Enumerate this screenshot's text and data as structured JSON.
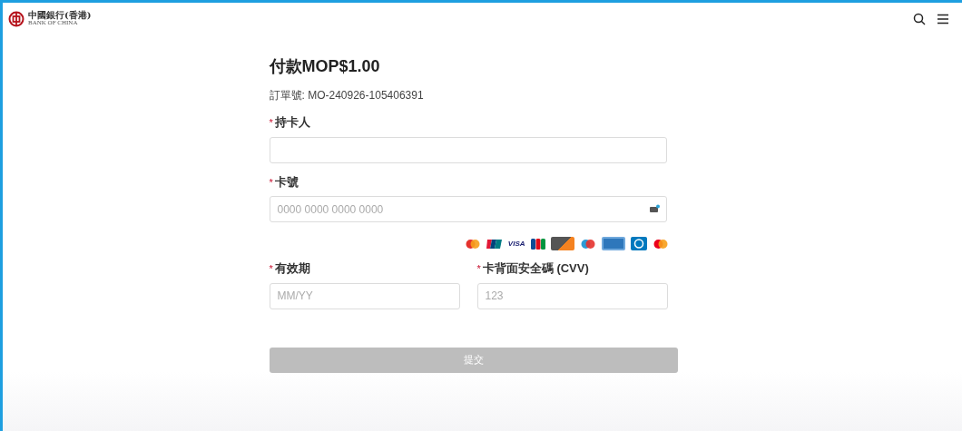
{
  "header": {
    "logo_text": "中國銀行(香港)",
    "logo_subtext": "BANK OF CHINA"
  },
  "title": "付款MOP$1.00",
  "order": "訂單號: MO-240926-105406391",
  "required_mark": "*",
  "holder": {
    "label": "持卡人",
    "required": true
  },
  "card_number": {
    "label": "卡號",
    "required": true,
    "placeholder": "0000 0000 0000 0000"
  },
  "brands": [
    {
      "kind": "mastercard-old"
    },
    {
      "kind": "unionpay"
    },
    {
      "kind": "visa",
      "label": "VISA"
    },
    {
      "kind": "jcb"
    },
    {
      "kind": "discover"
    },
    {
      "kind": "maestro"
    },
    {
      "kind": "amex"
    },
    {
      "kind": "diners"
    },
    {
      "kind": "mastercard"
    }
  ],
  "expiry": {
    "label": "有效期",
    "required": true,
    "placeholder": "MM/YY"
  },
  "cvv": {
    "label": "卡背面安全碼 (CVV)",
    "required": true,
    "placeholder": "123"
  },
  "submit": {
    "label": "提交",
    "disabled": true
  }
}
